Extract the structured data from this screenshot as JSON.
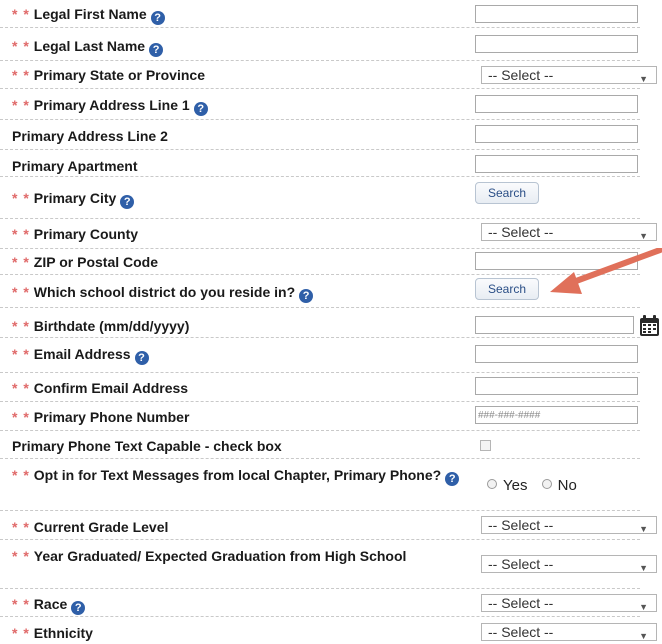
{
  "fields": {
    "first_name": {
      "label": "Legal First Name",
      "required": "* *",
      "help": "?"
    },
    "last_name": {
      "label": "Legal Last Name",
      "required": "* *",
      "help": "?"
    },
    "state": {
      "label": "Primary State or Province",
      "required": "* *",
      "value": "-- Select --"
    },
    "address1": {
      "label": "Primary Address Line 1",
      "required": "* *",
      "help": "?"
    },
    "address2": {
      "label": "Primary Address Line 2"
    },
    "apartment": {
      "label": "Primary Apartment"
    },
    "city": {
      "label": "Primary City",
      "required": "* *",
      "help": "?",
      "button": "Search"
    },
    "county": {
      "label": "Primary County",
      "required": "* *",
      "value": "-- Select --"
    },
    "zip": {
      "label": "ZIP or Postal Code",
      "required": "* *"
    },
    "district": {
      "label": "Which school district do you reside in?",
      "required": "* *",
      "help": "?",
      "button": "Search"
    },
    "birthdate": {
      "label": "Birthdate (mm/dd/yyyy)",
      "required": "* *"
    },
    "email": {
      "label": "Email Address",
      "required": "* *",
      "help": "?"
    },
    "confirm_email": {
      "label": "Confirm Email Address",
      "required": "* *"
    },
    "phone": {
      "label": "Primary Phone Number",
      "required": "* *",
      "placeholder": "###-###-####"
    },
    "text_capable": {
      "label": "Primary Phone Text Capable - check box"
    },
    "opt_in": {
      "label": "Opt in for Text Messages from local Chapter, Primary Phone?",
      "required": "* *",
      "help": "?",
      "yes": "Yes",
      "no": "No"
    },
    "grade": {
      "label": "Current Grade Level",
      "required": "* *",
      "value": "-- Select --"
    },
    "graduated": {
      "label": "Year Graduated/ Expected Graduation from High School",
      "required": "* *",
      "value": "-- Select --"
    },
    "race": {
      "label": "Race",
      "required": "* *",
      "help": "?",
      "value": "-- Select --"
    },
    "ethnicity": {
      "label": "Ethnicity",
      "required": "* *",
      "value": "-- Select --"
    }
  },
  "colors": {
    "required": "#e06a6a",
    "help_icon": "#2f5fa8",
    "arrow_annotation": "#e0705a"
  },
  "icons": {
    "help": "question-circle-icon",
    "calendar": "calendar-icon",
    "dropdown": "chevron-down-icon"
  }
}
